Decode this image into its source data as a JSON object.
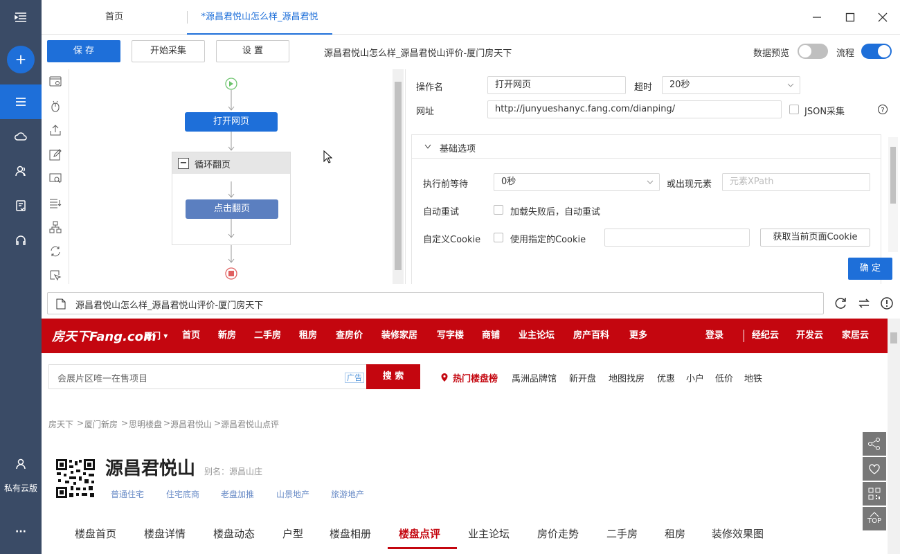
{
  "sidebar": {
    "bottom_label": "私有云版",
    "more": "···"
  },
  "tabs": [
    {
      "label": "首页"
    },
    {
      "label": "*源昌君悦山怎么样_源昌君悦"
    }
  ],
  "toolbar": {
    "save": "保 存",
    "start": "开始采集",
    "settings": "设 置",
    "page_title": "源昌君悦山怎么样_源昌君悦山评价-厦门房天下",
    "data_preview": "数据预览",
    "data_preview_on": false,
    "flow": "流程",
    "flow_on": true
  },
  "flow": {
    "open_page": "打开网页",
    "loop_label": "循环翻页",
    "click_page": "点击翻页",
    "collapse": "−"
  },
  "panel": {
    "op_name_label": "操作名",
    "op_name_value": "打开网页",
    "timeout_label": "超时",
    "timeout_value": "20秒",
    "url_label": "网址",
    "url_value": "http://junyueshanyc.fang.com/dianping/",
    "json_label": "JSON采集",
    "section_title": "基础选项",
    "wait_label": "执行前等待",
    "wait_value": "0秒",
    "or_elem_label": "或出现元素",
    "xpath_placeholder": "元素XPath",
    "retry_label": "自动重试",
    "retry_option": "加载失败后，自动重试",
    "cookie_label": "自定义Cookie",
    "cookie_option": "使用指定的Cookie",
    "get_cookie": "获取当前页面Cookie",
    "confirm": "确 定"
  },
  "urlbar": {
    "title": "源昌君悦山怎么样_源昌君悦山评价-厦门房天下"
  },
  "web": {
    "logo": "房天下Fang.com",
    "city": "厦门",
    "nav": [
      "首页",
      "新房",
      "二手房",
      "租房",
      "查房价",
      "装修家居",
      "写字楼",
      "商铺",
      "业主论坛",
      "房产百科",
      "更多"
    ],
    "right_nav": [
      "登录",
      "经纪云",
      "开发云",
      "家居云"
    ],
    "search_placeholder": "会展片区唯一在售项目",
    "ad": "广告",
    "search_button": "搜 索",
    "hot_title": "热门楼盘榜",
    "hot_links": [
      "禹洲品牌馆",
      "新开盘",
      "地图找房",
      "优惠",
      "小户",
      "低价",
      "地铁"
    ],
    "breadcrumb": [
      "房天下",
      ">",
      "厦门新房",
      ">",
      "思明楼盘",
      ">",
      "源昌君悦山",
      ">",
      "源昌君悦山点评"
    ],
    "project_name": "源昌君悦山",
    "alias": "别名：源昌山庄",
    "tags": [
      "普通住宅",
      "住宅底商",
      "老盘加推",
      "山景地产",
      "旅游地产"
    ],
    "subnav": [
      "楼盘首页",
      "楼盘详情",
      "楼盘动态",
      "户型",
      "楼盘相册",
      "楼盘点评",
      "业主论坛",
      "房价走势",
      "二手房",
      "租房",
      "装修效果图"
    ],
    "top_label": "TOP"
  },
  "colors": {
    "primary": "#1e6fd9",
    "sidebar": "#3a4b66",
    "brand_red": "#c4060f",
    "flow_node": "#1e6fd9",
    "flow_node_inner": "#5b7fc0"
  }
}
